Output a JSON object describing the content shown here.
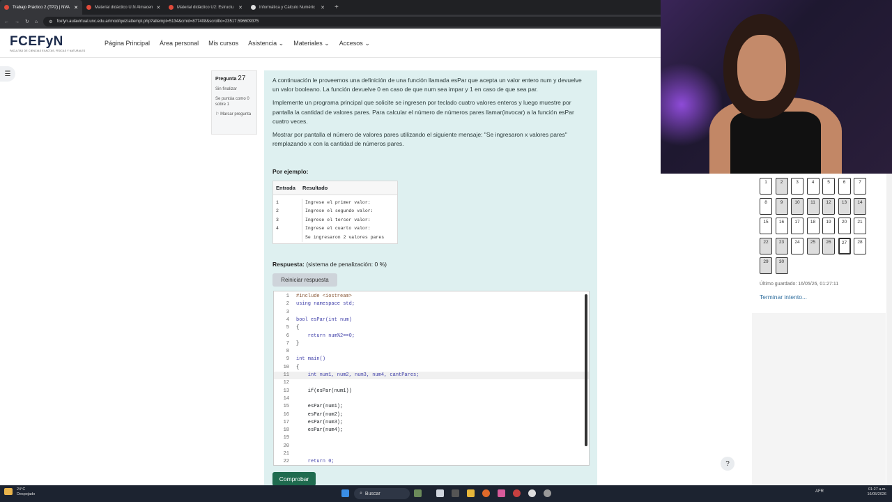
{
  "browser": {
    "tabs": [
      {
        "label": "Trabajo Práctico 2 (TP2) | NVA",
        "active": true
      },
      {
        "label": "Material didáctico U.N Almacen",
        "active": false
      },
      {
        "label": "Material didáctico U2: Estructu",
        "active": false
      },
      {
        "label": "Informática y Cálculo Numéric",
        "active": false
      }
    ],
    "url": "fcefyn.aulavirtual.unc.edu.ar/mod/quiz/attempt.php?attempt=5134&cmid=877408&scrollto=23517.596609375"
  },
  "site": {
    "logo_text": "FCEFyN",
    "logo_subtitle": "FACULTAD DE CIENCIAS EXACTAS, FÍSICAS Y NATURALES",
    "nav": [
      "Página Principal",
      "Área personal",
      "Mis cursos",
      "Asistencia",
      "Materiales",
      "Accesos"
    ]
  },
  "question_info": {
    "label": "Pregunta",
    "number": "27",
    "status": "Sin finalizar",
    "score": "Se puntúa como 0 sobre 1",
    "flag": "Marcar pregunta"
  },
  "question": {
    "p1": "A continuación le proveemos una definición de una función llamada esPar que acepta un valor entero num y devuelve un valor booleano. La función devuelve 0 en caso de que num sea impar y 1 en caso de que sea par.",
    "p2": "Implemente un programa principal que solicite se ingresen por teclado cuatro valores enteros y luego muestre por pantalla la cantidad de valores pares. Para calcular el número de números pares llamar(invocar) a la función esPar cuatro veces.",
    "p3": "Mostrar por pantalla el número de valores pares utilizando el siguiente mensaje: \"Se ingresaron x valores pares\" remplazando x con la cantidad de números pares.",
    "example_label": "Por ejemplo:",
    "table": {
      "headers": [
        "Entrada",
        "Resultado"
      ],
      "inputs": [
        "1",
        "2",
        "3",
        "4"
      ],
      "outputs": [
        "Ingrese el primer valor:",
        "Ingrese el segundo valor:",
        "Ingrese el tercer valor:",
        "Ingrese el cuarto valor:",
        "Se ingresaron 2 valores pares"
      ]
    },
    "answer_label": "Respuesta:",
    "penalty": "(sistema de penalización: 0 %)",
    "reset_button": "Reiniciar respuesta",
    "check_button": "Comprobar"
  },
  "code_lines": [
    {
      "n": "1",
      "text": "#include <iostream>"
    },
    {
      "n": "2",
      "text": "using namespace std;"
    },
    {
      "n": "3",
      "text": ""
    },
    {
      "n": "4",
      "text": "bool esPar(int num)"
    },
    {
      "n": "5",
      "text": "{"
    },
    {
      "n": "6",
      "text": "    return num%2==0;"
    },
    {
      "n": "7",
      "text": "}"
    },
    {
      "n": "8",
      "text": ""
    },
    {
      "n": "9",
      "text": "int main()"
    },
    {
      "n": "10",
      "text": "{"
    },
    {
      "n": "11",
      "text": "    int num1, num2, num3, num4, cantPares;"
    },
    {
      "n": "12",
      "text": ""
    },
    {
      "n": "13",
      "text": "    if(esPar(num1))"
    },
    {
      "n": "14",
      "text": ""
    },
    {
      "n": "15",
      "text": "    esPar(num1);"
    },
    {
      "n": "16",
      "text": "    esPar(num2);"
    },
    {
      "n": "17",
      "text": "    esPar(num3);"
    },
    {
      "n": "18",
      "text": "    esPar(num4);"
    },
    {
      "n": "19",
      "text": ""
    },
    {
      "n": "20",
      "text": ""
    },
    {
      "n": "21",
      "text": ""
    },
    {
      "n": "22",
      "text": "    return 0;"
    }
  ],
  "quiz_nav": {
    "buttons": [
      "1",
      "2",
      "3",
      "4",
      "5",
      "6",
      "7",
      "8",
      "9",
      "10",
      "11",
      "12",
      "13",
      "14",
      "15",
      "16",
      "17",
      "18",
      "19",
      "20",
      "21",
      "22",
      "23",
      "24",
      "25",
      "26",
      "27",
      "28",
      "29",
      "30"
    ],
    "saved": "Último guardado: 16/05/26, 01:27:11",
    "finish": "Terminar intento..."
  },
  "help": "?",
  "taskbar": {
    "weather_temp": "24°C",
    "weather_desc": "Despejado",
    "search": "Buscar",
    "lang": "AFR",
    "time": "01:27 a.m.",
    "date": "16/05/2026"
  }
}
